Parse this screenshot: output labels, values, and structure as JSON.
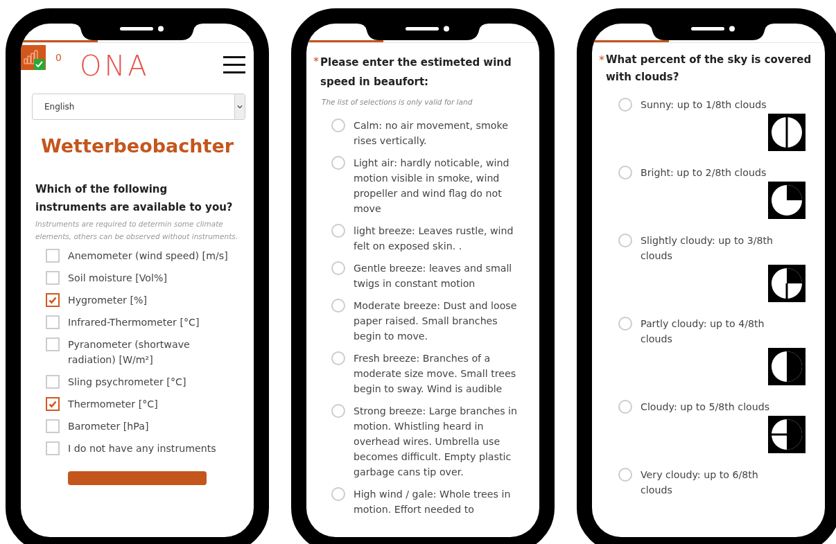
{
  "screens": [
    {
      "kind": "checklist",
      "progress": {
        "level": 0.33
      },
      "header": {
        "count": "0",
        "logo": "ONA"
      },
      "language": {
        "value": "English"
      },
      "title": "Wetterbeobachter",
      "question": {
        "text": "Which of the following instruments are available to you?",
        "hint": "Instruments are required to determin some climate elements, others can be observed without instruments."
      },
      "options": [
        {
          "label": "Anemometer (wind speed) [m/s]",
          "checked": false
        },
        {
          "label": "Soil moisture [Vol%]",
          "checked": false
        },
        {
          "label": "Hygrometer [%]",
          "checked": true
        },
        {
          "label": "Infrared-Thermometer [°C]",
          "checked": false
        },
        {
          "label": "Pyranometer (shortwave radiation) [W/m²]",
          "checked": false
        },
        {
          "label": "Sling psychrometer [°C]",
          "checked": false
        },
        {
          "label": "Thermometer [°C]",
          "checked": true
        },
        {
          "label": "Barometer [hPa]",
          "checked": false
        },
        {
          "label": "I do not have any instruments",
          "checked": false
        }
      ]
    },
    {
      "kind": "radiolist",
      "progress": {
        "level": 0.33
      },
      "question": {
        "marker": "*",
        "text": "Please enter the estimeted wind speed in beaufort:",
        "hint": "The list of selections is only valid for land"
      },
      "options": [
        {
          "label": "Calm: no air movement, smoke rises vertically.",
          "selected": false
        },
        {
          "label": "Light air: hardly noticable, wind motion visible in smoke, wind propeller and wind flag do not move",
          "selected": false
        },
        {
          "label": "light breeze: Leaves rustle, wind felt on exposed skin. .",
          "selected": false
        },
        {
          "label": "Gentle breeze: leaves and small twigs in constant motion",
          "selected": false
        },
        {
          "label": "Moderate breeze: Dust and loose paper raised. Small branches begin to move.",
          "selected": false
        },
        {
          "label": "Fresh breeze: Branches of a moderate size move. Small trees begin to sway. Wind is audible",
          "selected": false
        },
        {
          "label": "Strong breeze: Large branches in motion. Whistling heard in overhead wires. Umbrella use becomes difficult. Empty plastic garbage cans tip over.",
          "selected": false
        },
        {
          "label": "High wind / gale: Whole trees in motion. Effort needed to",
          "selected": false
        }
      ]
    },
    {
      "kind": "radiolist",
      "progress": {
        "level": 0.33
      },
      "question": {
        "marker": "*",
        "text": "What percent of the sky is covered with clouds?"
      },
      "options": [
        {
          "label": "Sunny: up to 1/8th clouds",
          "selected": false,
          "kind": "okta1"
        },
        {
          "label": "Bright: up to 2/8th clouds",
          "selected": false,
          "kind": "okta2"
        },
        {
          "label": "Slightly cloudy: up to 3/8th clouds",
          "selected": false,
          "kind": "okta3"
        },
        {
          "label": "Partly cloudy: up to 4/8th clouds",
          "selected": false,
          "kind": "okta4"
        },
        {
          "label": "Cloudy: up to 5/8th clouds",
          "selected": false,
          "kind": "okta5"
        },
        {
          "label": "Very cloudy: up to 6/8th clouds",
          "selected": false
        }
      ]
    }
  ]
}
